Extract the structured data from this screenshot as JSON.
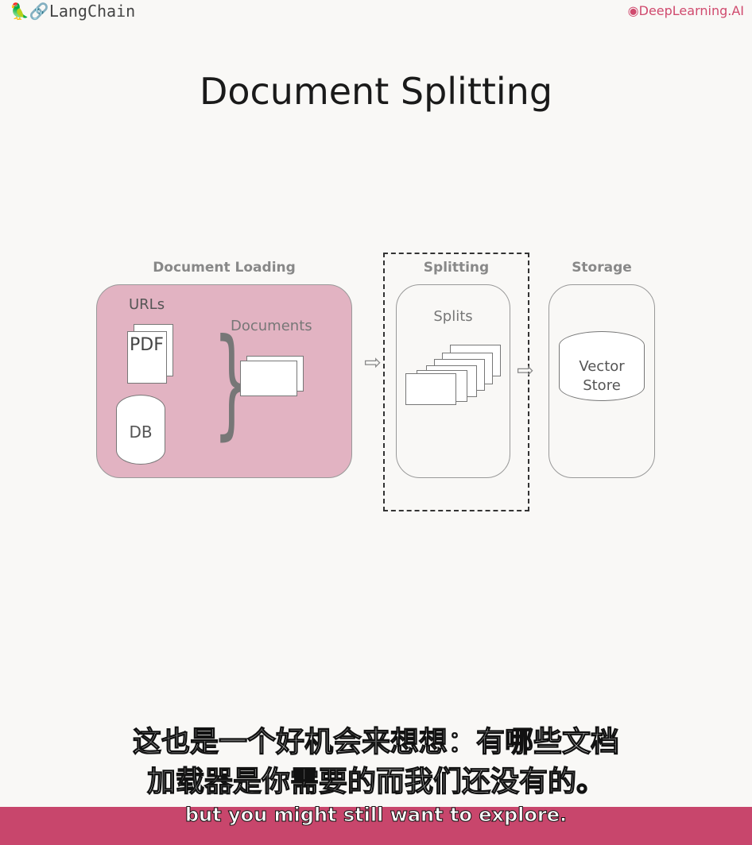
{
  "header": {
    "left_logo": "LangChain",
    "right_logo": "DeepLearning.AI",
    "accent": "#d04a6e"
  },
  "title": "Document Splitting",
  "diagram": {
    "loading": {
      "heading": "Document Loading",
      "urls": "URLs",
      "pdf": "PDF",
      "db": "DB",
      "documents": "Documents",
      "fill": "#e2b3c2"
    },
    "splitting": {
      "heading": "Splitting",
      "splits": "Splits"
    },
    "storage": {
      "heading": "Storage",
      "store_line1": "Vector",
      "store_line2": "Store"
    }
  },
  "subtitles": {
    "zh_line1": "这也是一个好机会来想想：有哪些文档",
    "zh_line2": "加载器是你需要的而我们还没有的。",
    "en": "but you might still want to explore.",
    "bar_color": "#c8466c"
  }
}
